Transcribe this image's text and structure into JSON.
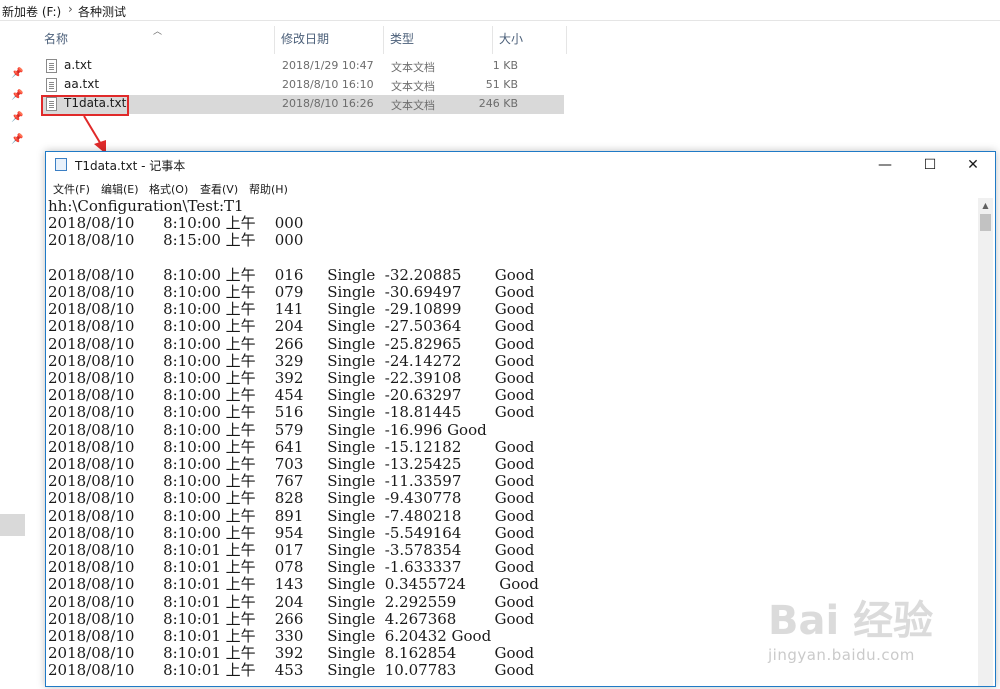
{
  "breadcrumb": {
    "drive": "新加卷 (F:)",
    "separator": "›",
    "folder": "各种测试"
  },
  "columns": {
    "name": "名称",
    "modified": "修改日期",
    "type": "类型",
    "size": "大小"
  },
  "files": [
    {
      "name": "a.txt",
      "modified": "2018/1/29 10:47",
      "type": "文本文档",
      "size": "1 KB"
    },
    {
      "name": "aa.txt",
      "modified": "2018/8/10 16:10",
      "type": "文本文档",
      "size": "51 KB"
    },
    {
      "name": "T1data.txt",
      "modified": "2018/8/10 16:26",
      "type": "文本文档",
      "size": "246 KB"
    }
  ],
  "notepad": {
    "title": "T1data.txt - 记事本",
    "controls": {
      "minimize": "—",
      "maximize": "☐",
      "close": "✕"
    },
    "menu": [
      "文件(F)",
      "编辑(E)",
      "格式(O)",
      "查看(V)",
      "帮助(H)"
    ],
    "lines": [
      "hh:\\Configuration\\Test:T1",
      "2018/08/10      8:10:00 上午    000",
      "2018/08/10      8:15:00 上午    000",
      "",
      "2018/08/10      8:10:00 上午    016     Single  -32.20885       Good",
      "2018/08/10      8:10:00 上午    079     Single  -30.69497       Good",
      "2018/08/10      8:10:00 上午    141     Single  -29.10899       Good",
      "2018/08/10      8:10:00 上午    204     Single  -27.50364       Good",
      "2018/08/10      8:10:00 上午    266     Single  -25.82965       Good",
      "2018/08/10      8:10:00 上午    329     Single  -24.14272       Good",
      "2018/08/10      8:10:00 上午    392     Single  -22.39108       Good",
      "2018/08/10      8:10:00 上午    454     Single  -20.63297       Good",
      "2018/08/10      8:10:00 上午    516     Single  -18.81445       Good",
      "2018/08/10      8:10:00 上午    579     Single  -16.996 Good",
      "2018/08/10      8:10:00 上午    641     Single  -15.12182       Good",
      "2018/08/10      8:10:00 上午    703     Single  -13.25425       Good",
      "2018/08/10      8:10:00 上午    767     Single  -11.33597       Good",
      "2018/08/10      8:10:00 上午    828     Single  -9.430778       Good",
      "2018/08/10      8:10:00 上午    891     Single  -7.480218       Good",
      "2018/08/10      8:10:00 上午    954     Single  -5.549164       Good",
      "2018/08/10      8:10:01 上午    017     Single  -3.578354       Good",
      "2018/08/10      8:10:01 上午    078     Single  -1.633337       Good",
      "2018/08/10      8:10:01 上午    143     Single  0.3455724       Good",
      "2018/08/10      8:10:01 上午    204     Single  2.292559        Good",
      "2018/08/10      8:10:01 上午    266     Single  4.267368        Good",
      "2018/08/10      8:10:01 上午    330     Single  6.20432 Good",
      "2018/08/10      8:10:01 上午    392     Single  8.162854        Good",
      "2018/08/10      8:10:01 上午    453     Single  10.07783        Good"
    ]
  },
  "watermark": {
    "brand": "Bai 经验",
    "url": "jingyan.baidu.com"
  },
  "colors": {
    "highlight_border": "#e02a2a",
    "selected_row": "#d9d9d9",
    "window_border": "#1f7ac6"
  }
}
